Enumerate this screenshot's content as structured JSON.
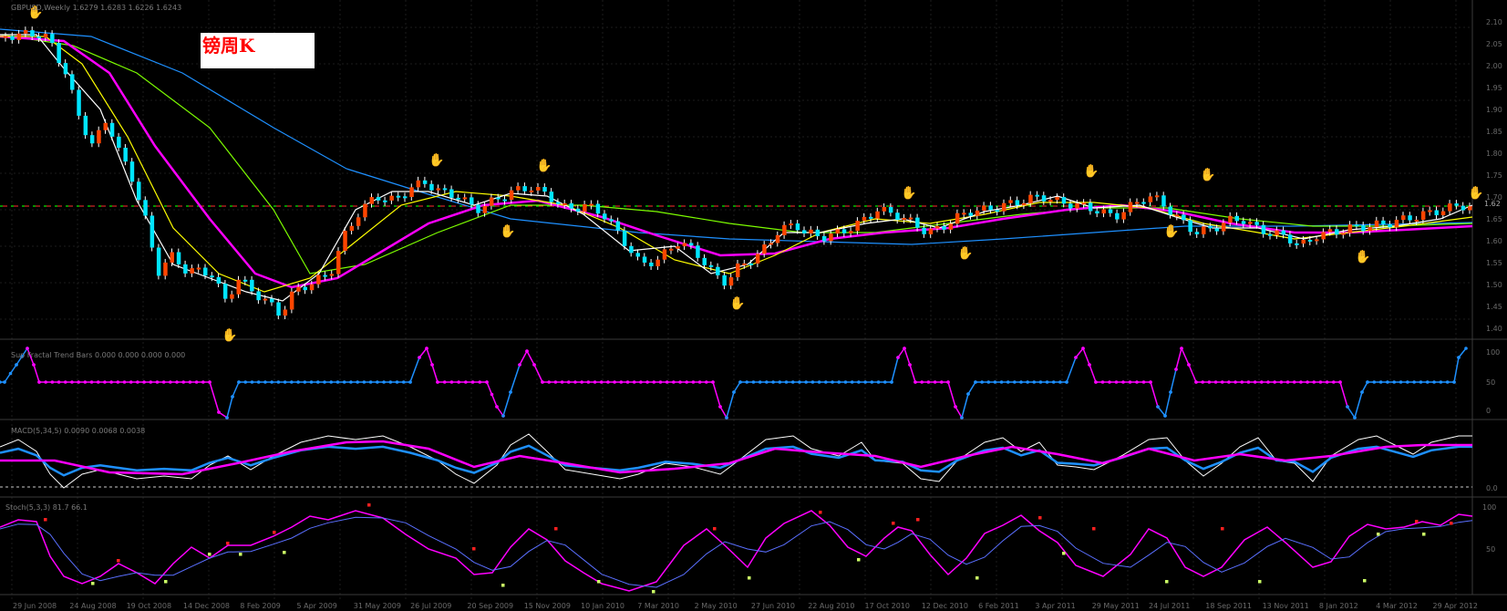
{
  "annotation": {
    "label": "镑周K"
  },
  "main": {
    "title": "GBPUSD,Weekly 1.6279 1.6283 1.6226 1.6243",
    "level_line": "1.62",
    "price_labels": [
      "2.10",
      "2.05",
      "2.00",
      "1.95",
      "1.90",
      "1.85",
      "1.80",
      "1.75",
      "1.70",
      "1.65",
      "1.60",
      "1.55",
      "1.50",
      "1.45",
      "1.40"
    ]
  },
  "subpane1": {
    "title": "Sup Fractal Trend Bars 0.000 0.000 0.000 0.000",
    "labels": [
      "100",
      "50",
      "0"
    ]
  },
  "subpane2": {
    "title": "MACD(5,34,5) 0.0090 0.0068 0.0038",
    "labels": [
      "0.0"
    ]
  },
  "subpane3": {
    "title": "Stoch(5,3,3) 81.7 66.1",
    "labels": [
      "100",
      "50"
    ]
  },
  "date_axis": [
    "29 Jun 2008",
    "24 Aug 2008",
    "19 Oct 2008",
    "14 Dec 2008",
    "8 Feb 2009",
    "5 Apr 2009",
    "31 May 2009",
    "26 Jul 2009",
    "20 Sep 2009",
    "15 Nov 2009",
    "10 Jan 2010",
    "7 Mar 2010",
    "2 May 2010",
    "27 Jun 2010",
    "22 Aug 2010",
    "17 Oct 2010",
    "12 Dec 2010",
    "6 Feb 2011",
    "3 Apr 2011",
    "29 May 2011",
    "24 Jul 2011",
    "18 Sep 2011",
    "13 Nov 2011",
    "8 Jan 2012",
    "4 Mar 2012",
    "29 Apr 2012"
  ],
  "colors": {
    "bull_candle": "#ff4500",
    "bear_candle": "#00e5ff",
    "wick": "#ffffff",
    "ma_fast": "#ffffff",
    "ma_yellow": "#ffff00",
    "ma_magenta": "#ff00ff",
    "ma_green": "#7cfc00",
    "ma_slow": "#1e90ff",
    "level_green": "#00c000",
    "level_red": "#ff3030",
    "fractal_up": "#ff0000",
    "fractal_down": "#1e90ff",
    "trend_up": "#1e90ff",
    "trend_down": "#ff00ff"
  }
}
